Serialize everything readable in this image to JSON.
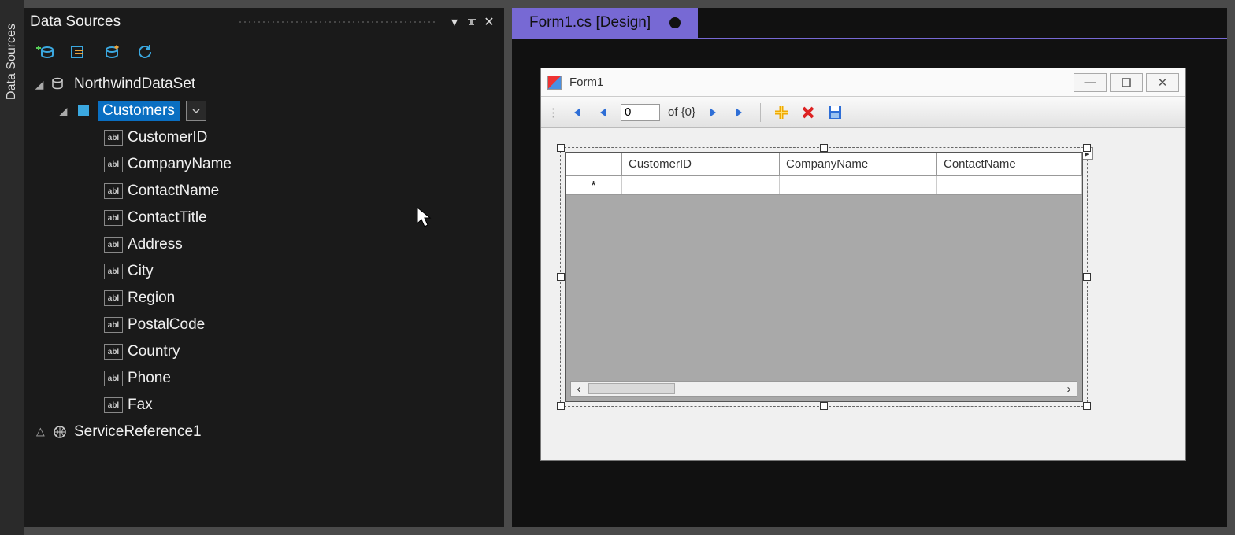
{
  "sidebar": {
    "tab_label": "Data Sources",
    "panel_title": "Data Sources",
    "tree": {
      "dataset": "NorthwindDataSet",
      "table": "Customers",
      "fields": [
        "CustomerID",
        "CompanyName",
        "ContactName",
        "ContactTitle",
        "Address",
        "City",
        "Region",
        "PostalCode",
        "Country",
        "Phone",
        "Fax"
      ],
      "service_ref": "ServiceReference1"
    }
  },
  "editor": {
    "tab_label": "Form1.cs [Design]",
    "form_title": "Form1",
    "binding_nav": {
      "position": "0",
      "count_text": "of {0}"
    },
    "grid": {
      "columns": [
        "CustomerID",
        "CompanyName",
        "ContactName"
      ],
      "new_row_marker": "*"
    }
  }
}
